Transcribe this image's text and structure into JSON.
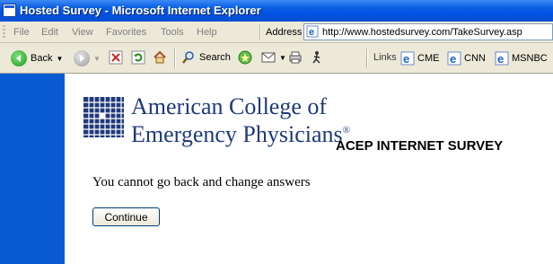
{
  "window": {
    "title": "Hosted Survey - Microsoft Internet Explorer"
  },
  "menubar": {
    "items": [
      "File",
      "Edit",
      "View",
      "Favorites",
      "Tools",
      "Help"
    ],
    "address_label": "Address",
    "url": "http://www.hostedsurvey.com/TakeSurvey.asp"
  },
  "toolbar": {
    "back_label": "Back",
    "search_label": "Search",
    "links_label": "Links",
    "links": [
      "CME",
      "CNN",
      "MSNBC"
    ]
  },
  "page": {
    "org_line1": "American College of",
    "org_line2": "Emergency Physicians",
    "registered_mark": "®",
    "survey_title": "ACEP INTERNET SURVEY",
    "message": "You cannot go back and change answers",
    "continue_label": "Continue"
  },
  "colors": {
    "titlebar": "#0054e3",
    "sidebar": "#0a5bd3",
    "logo": "#1f3a7a"
  }
}
